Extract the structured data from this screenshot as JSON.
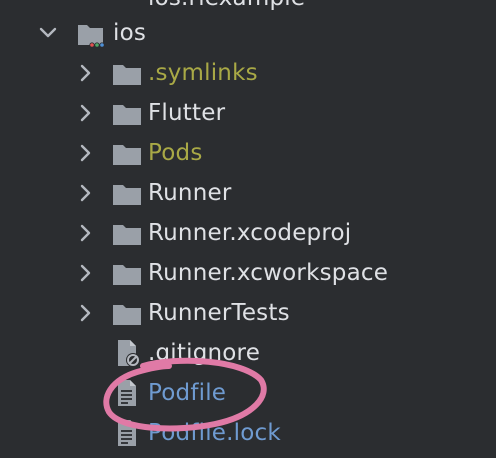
{
  "project_tree": {
    "cut_row_label": "ios.rlexample",
    "ios_folder": {
      "label": "ios",
      "expanded": true
    },
    "items": [
      {
        "label": ".symlinks",
        "type": "folder",
        "color": "#a9a946"
      },
      {
        "label": "Flutter",
        "type": "folder",
        "color": "#dfe1e5"
      },
      {
        "label": "Pods",
        "type": "folder",
        "color": "#a9a946"
      },
      {
        "label": "Runner",
        "type": "folder",
        "color": "#dfe1e5"
      },
      {
        "label": "Runner.xcodeproj",
        "type": "folder",
        "color": "#dfe1e5"
      },
      {
        "label": "Runner.xcworkspace",
        "type": "folder",
        "color": "#dfe1e5"
      },
      {
        "label": "RunnerTests",
        "type": "folder",
        "color": "#dfe1e5"
      },
      {
        "label": ".gitignore",
        "type": "ignored-file",
        "color": "#dfe1e5"
      },
      {
        "label": "Podfile",
        "type": "text-file",
        "color": "#6f9bd1"
      },
      {
        "label": "Podfile.lock",
        "type": "text-file",
        "color": "#6f9bd1"
      }
    ],
    "colors": {
      "background": "#2b2d30",
      "folder_icon": "#9aa0a8",
      "chevron": "#b4b8bf",
      "highlight_circle": "#e07aa6"
    }
  }
}
